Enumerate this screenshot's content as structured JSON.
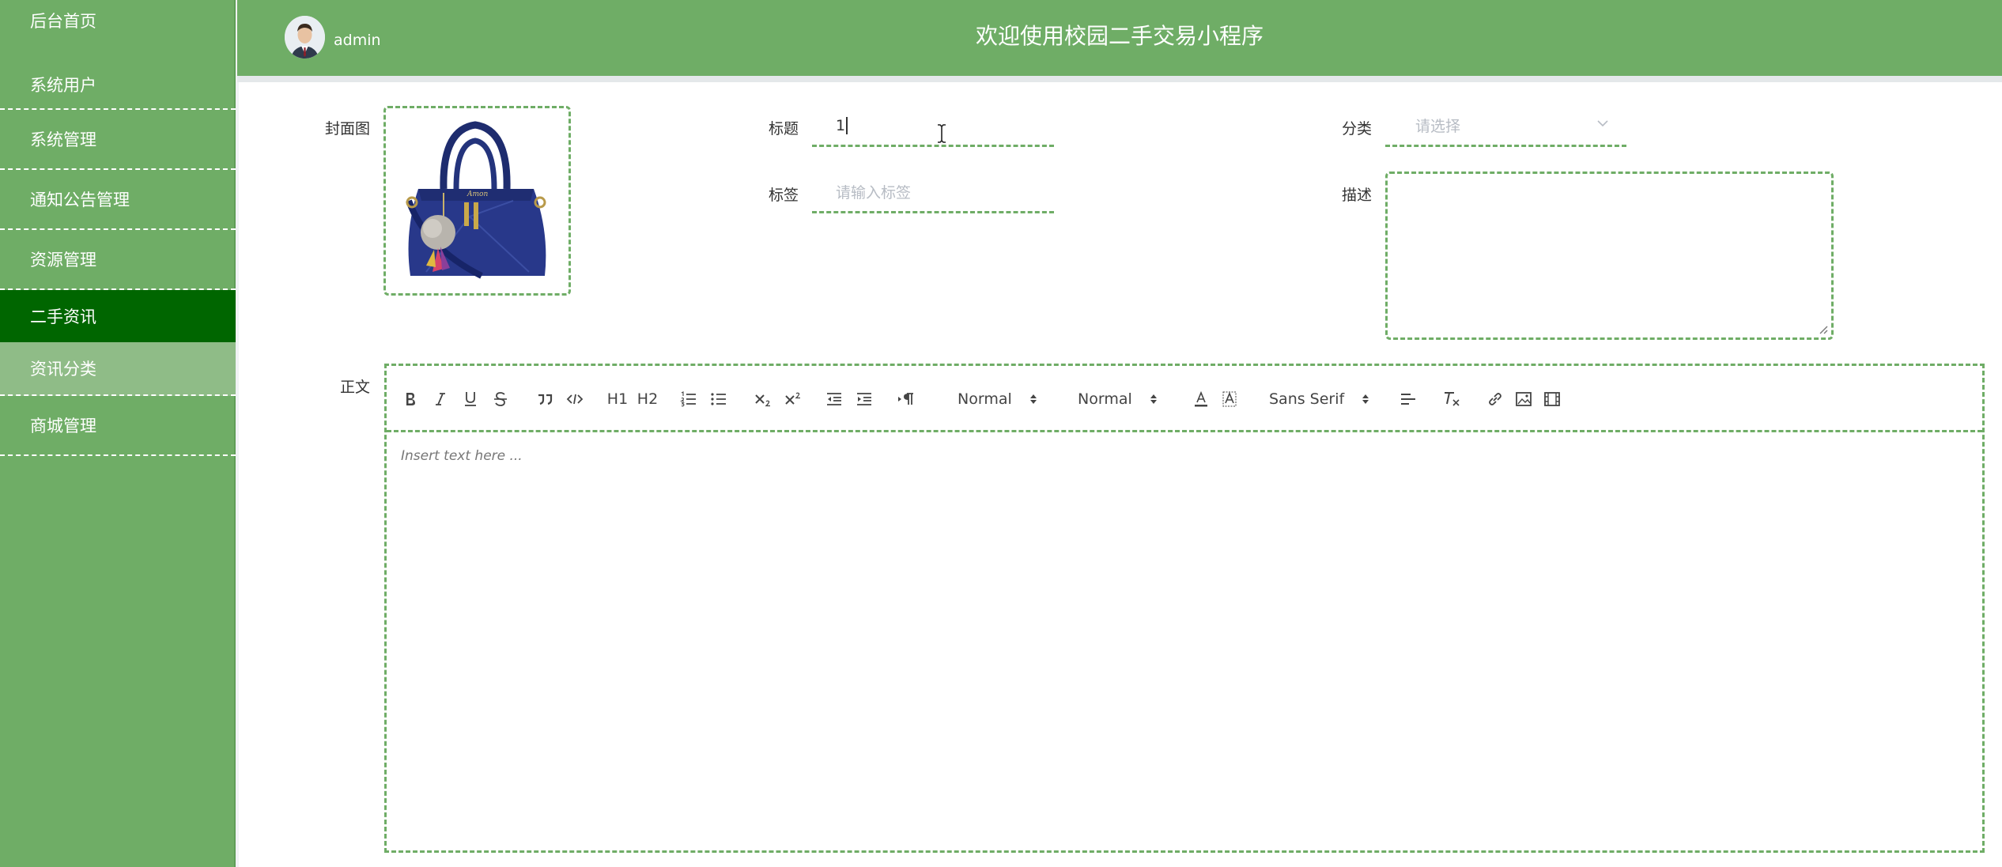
{
  "sidebar": {
    "items": [
      {
        "label": "后台首页"
      },
      {
        "label": "系统用户"
      },
      {
        "label": "系统管理"
      },
      {
        "label": "通知公告管理"
      },
      {
        "label": "资源管理"
      },
      {
        "label": "二手资讯"
      },
      {
        "label": "资讯分类"
      },
      {
        "label": "商城管理"
      }
    ]
  },
  "header": {
    "username": "admin",
    "title": "欢迎使用校园二手交易小程序"
  },
  "form": {
    "cover_label": "封面图",
    "title_label": "标题",
    "title_value": "1",
    "category_label": "分类",
    "category_placeholder": "请选择",
    "tag_label": "标签",
    "tag_placeholder": "请输入标签",
    "desc_label": "描述",
    "content_label": "正文"
  },
  "editor": {
    "header_select": "Normal",
    "size_select": "Normal",
    "font_select": "Sans Serif",
    "h1": "H1",
    "h2": "H2",
    "placeholder": "Insert text here ..."
  },
  "colors": {
    "accent": "#6fad66",
    "active": "#006600",
    "submenu": "#8fbc87"
  }
}
